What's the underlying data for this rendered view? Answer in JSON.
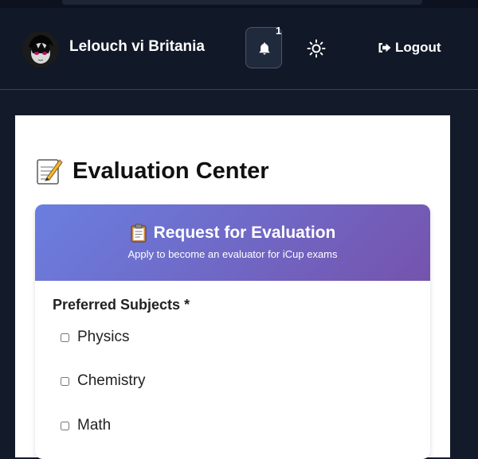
{
  "header": {
    "username": "Lelouch vi Britania",
    "notifications_count": "1",
    "logout_label": "Logout"
  },
  "page": {
    "title": "Evaluation Center"
  },
  "card": {
    "title": "Request for Evaluation",
    "subtitle": "Apply to become an evaluator for iCup exams",
    "field_label": "Preferred Subjects *",
    "subjects": [
      "Physics",
      "Chemistry",
      "Math"
    ]
  },
  "icons": {
    "avatar": "avatar-icon",
    "bell": "bell-icon",
    "theme": "sun-icon",
    "logout": "sign-out-icon",
    "memo": "memo-icon",
    "clipboard": "clipboard-icon"
  },
  "colors": {
    "header_bg": "#111827",
    "gradient_start": "#6a7fe0",
    "gradient_end": "#7553ad"
  }
}
